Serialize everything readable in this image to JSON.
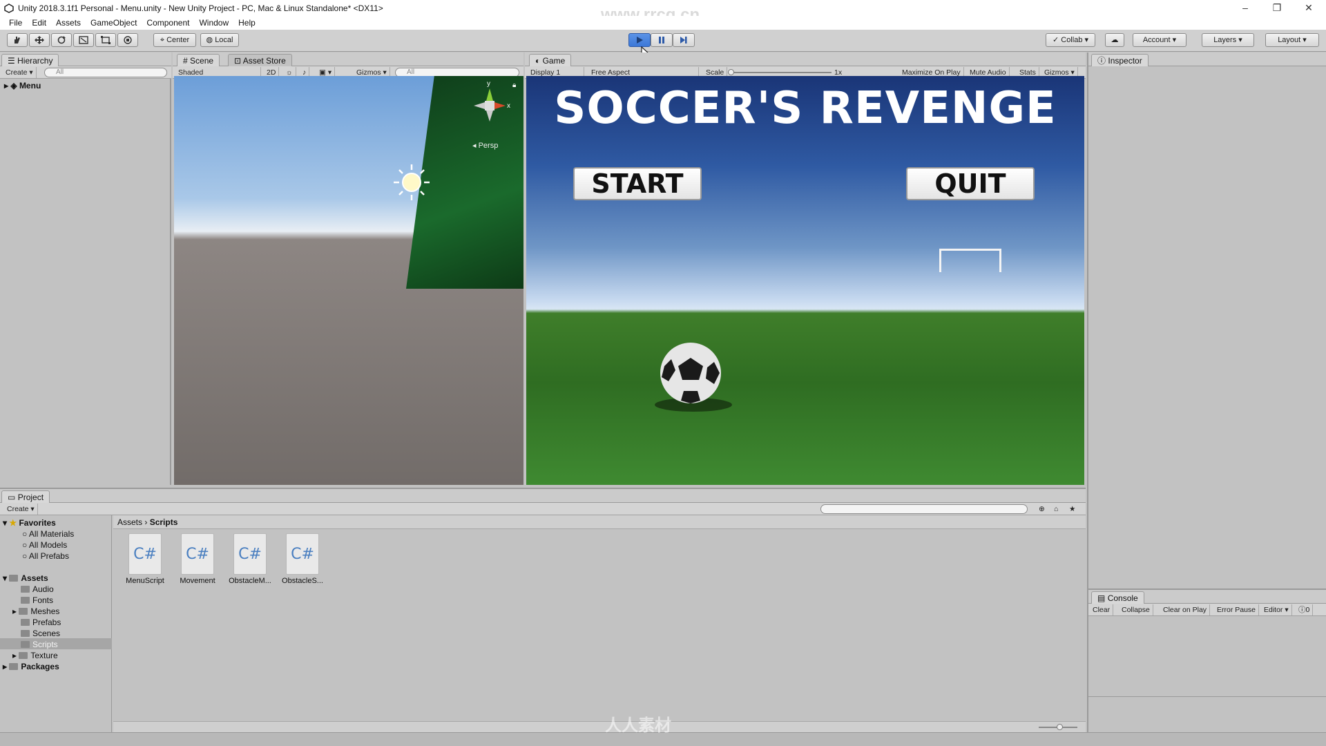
{
  "window": {
    "title": "Unity 2018.3.1f1 Personal - Menu.unity - New Unity Project - PC, Mac & Linux Standalone* <DX11>",
    "minimize": "–",
    "maximize": "❐",
    "close": "✕"
  },
  "menu": [
    "File",
    "Edit",
    "Assets",
    "GameObject",
    "Component",
    "Window",
    "Help"
  ],
  "watermark": "www.rrcg.cn",
  "toolbar": {
    "pivot": "Center",
    "space": "Local",
    "collab": "Collab",
    "account": "Account",
    "layers": "Layers",
    "layout": "Layout"
  },
  "hierarchy": {
    "tab": "Hierarchy",
    "create": "Create",
    "search_placeholder": "All",
    "root": "Menu"
  },
  "scene": {
    "tab": "Scene",
    "asset_store_tab": "Asset Store",
    "shading": "Shaded",
    "mode_2d": "2D",
    "gizmos": "Gizmos",
    "search_placeholder": "All",
    "projection": "Persp",
    "axis_y": "y",
    "axis_x": "x"
  },
  "game": {
    "tab": "Game",
    "display": "Display 1",
    "aspect": "Free Aspect",
    "scale_label": "Scale",
    "scale_value": "1x",
    "maximize": "Maximize On Play",
    "mute": "Mute Audio",
    "stats": "Stats",
    "gizmos": "Gizmos",
    "title": "SOCCER'S REVENGE",
    "start": "START",
    "quit": "QUIT"
  },
  "inspector": {
    "tab": "Inspector"
  },
  "project": {
    "tab": "Project",
    "create": "Create",
    "favorites": "Favorites",
    "favorite_items": [
      "All Materials",
      "All Models",
      "All Prefabs"
    ],
    "assets": "Assets",
    "folders": [
      "Audio",
      "Fonts",
      "Meshes",
      "Prefabs",
      "Scenes",
      "Scripts",
      "Texture"
    ],
    "packages": "Packages",
    "breadcrumb": [
      "Assets",
      "Scripts"
    ],
    "files": [
      {
        "icon": "C#",
        "name": "MenuScript"
      },
      {
        "icon": "C#",
        "name": "Movement"
      },
      {
        "icon": "C#",
        "name": "ObstacleM..."
      },
      {
        "icon": "C#",
        "name": "ObstacleS..."
      }
    ]
  },
  "console": {
    "tab": "Console",
    "clear": "Clear",
    "collapse": "Collapse",
    "clear_on_play": "Clear on Play",
    "error_pause": "Error Pause",
    "editor": "Editor",
    "count": "0"
  },
  "footer_watermark": "人人素材",
  "colors": {
    "play_active": "#3c78d8",
    "editor_bg": "#c2c2c2",
    "selection": "#a6a6a6"
  }
}
